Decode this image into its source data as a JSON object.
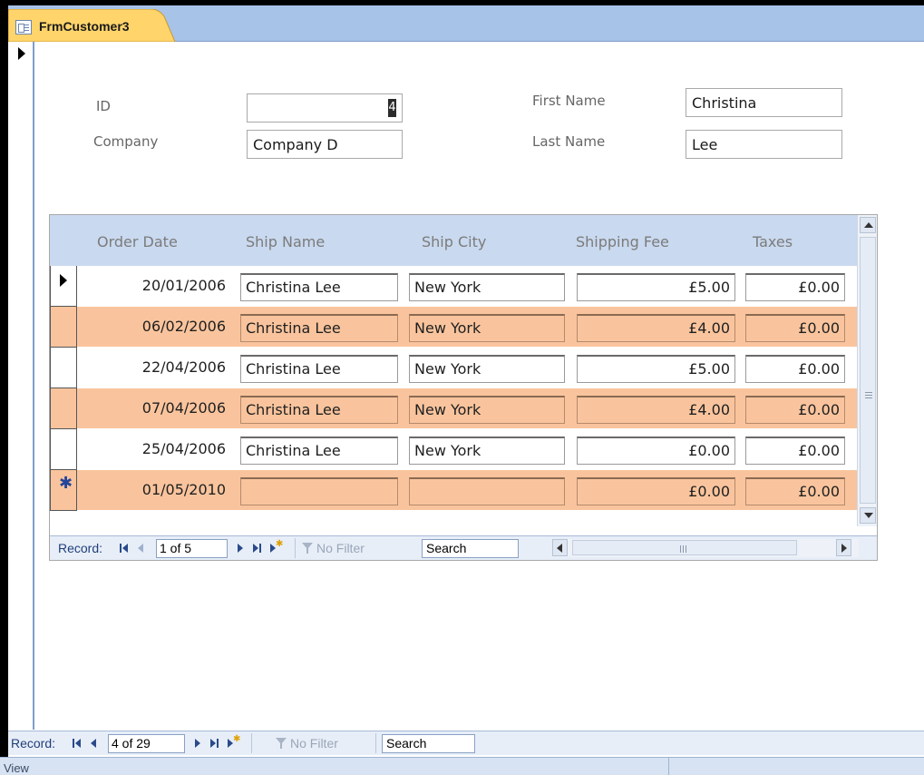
{
  "window": {
    "tab_title": "FrmCustomer3"
  },
  "form": {
    "labels": {
      "id": "ID",
      "company": "Company",
      "first_name": "First Name",
      "last_name": "Last Name"
    },
    "values": {
      "id": "4",
      "company": "Company D",
      "first_name": "Christina",
      "last_name": "Lee"
    }
  },
  "subform": {
    "columns": [
      "Order Date",
      "Ship Name",
      "Ship City",
      "Shipping Fee",
      "Taxes"
    ],
    "rows": [
      {
        "order_date": "20/01/2006",
        "ship_name": "Christina Lee",
        "ship_city": "New York",
        "shipping_fee": "£5.00",
        "taxes": "£0.00"
      },
      {
        "order_date": "06/02/2006",
        "ship_name": "Christina Lee",
        "ship_city": "New York",
        "shipping_fee": "£4.00",
        "taxes": "£0.00"
      },
      {
        "order_date": "22/04/2006",
        "ship_name": "Christina Lee",
        "ship_city": "New York",
        "shipping_fee": "£5.00",
        "taxes": "£0.00"
      },
      {
        "order_date": "07/04/2006",
        "ship_name": "Christina Lee",
        "ship_city": "New York",
        "shipping_fee": "£4.00",
        "taxes": "£0.00"
      },
      {
        "order_date": "25/04/2006",
        "ship_name": "Christina Lee",
        "ship_city": "New York",
        "shipping_fee": "£0.00",
        "taxes": "£0.00"
      },
      {
        "order_date": "01/05/2010",
        "ship_name": "",
        "ship_city": "",
        "shipping_fee": "£0.00",
        "taxes": "£0.00"
      }
    ],
    "navigation": {
      "record_label": "Record:",
      "position": "1 of 5",
      "filter_label": "No Filter",
      "search_label": "Search"
    }
  },
  "main_navigation": {
    "record_label": "Record:",
    "position": "4 of 29",
    "filter_label": "No Filter",
    "search_label": "Search"
  },
  "status": {
    "view_text": "View"
  },
  "colors": {
    "alt_row": "#f9c49d",
    "header_bg": "#c9d9ef",
    "tab_bar": "#a8c3e8",
    "tab_active": "#ffd46b"
  },
  "icons": {
    "tab": "form-icon",
    "current_record": "record-pointer-icon",
    "new_record": "new-record-asterisk-icon",
    "filter": "filter-icon"
  }
}
